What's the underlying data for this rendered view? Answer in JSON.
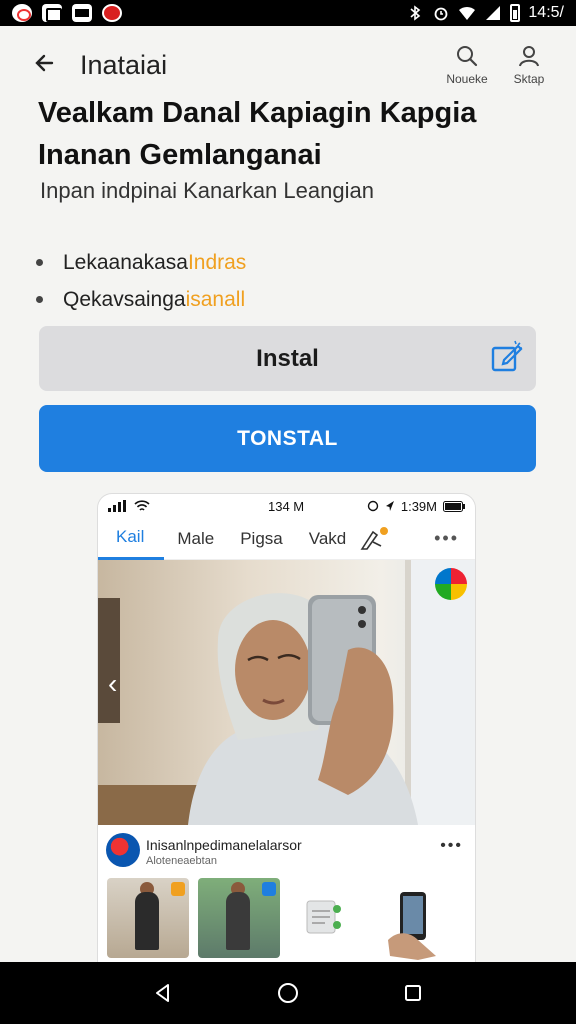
{
  "status_bar": {
    "time": "14:5/",
    "icons": [
      "app-a-icon",
      "app-b-icon",
      "app-c-icon",
      "app-d-icon",
      "bluetooth-icon",
      "alarm-icon",
      "wifi-icon",
      "signal-icon",
      "battery-icon"
    ]
  },
  "header": {
    "title": "Inataiai",
    "search_label": "Noueke",
    "profile_label": "Sktap"
  },
  "headline": "Vealkam Danal Kapiagin Kapgia Inanan Gemlanganai",
  "subline": "Inpan indpinai  Kanarkan Leangian",
  "bullets": [
    {
      "text": "Lekaanakasa",
      "highlight": "Indras"
    },
    {
      "text": "Qekavsainga",
      "highlight": "isanall"
    }
  ],
  "buttons": {
    "install_gray": "Instal",
    "install_blue": "TONSTAL"
  },
  "mockup": {
    "status_time": "134 M",
    "status_right": "1:39M",
    "tabs": [
      "Kail",
      "Male",
      "Pigsa",
      "Vakd"
    ],
    "active_tab": "Kail",
    "card_title": "Inisanlnpedimanelalarsor",
    "card_sub": "Aloteneaebtan"
  },
  "colors": {
    "accent": "#1f7fe0",
    "highlight": "#f0a020",
    "gray_button": "#dcdcde"
  }
}
